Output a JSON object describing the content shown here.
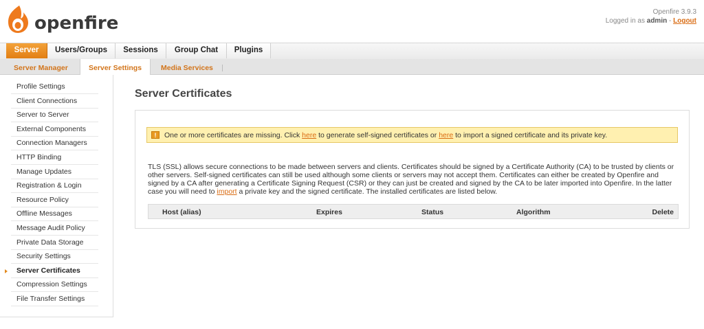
{
  "header": {
    "logo_text": "openfire",
    "logo_tm": "™",
    "version": "Openfire 3.9.3",
    "logged_in_prefix": "Logged in as",
    "username": "admin",
    "separator": "-",
    "logout_label": "Logout"
  },
  "main_tabs": [
    "Server",
    "Users/Groups",
    "Sessions",
    "Group Chat",
    "Plugins"
  ],
  "sub_tabs": [
    "Server Manager",
    "Server Settings",
    "Media Services"
  ],
  "sidebar": {
    "items": [
      "Profile Settings",
      "Client Connections",
      "Server to Server",
      "External Components",
      "Connection Managers",
      "HTTP Binding",
      "Manage Updates",
      "Registration & Login",
      "Resource Policy",
      "Offline Messages",
      "Message Audit Policy",
      "Private Data Storage",
      "Security Settings",
      "Server Certificates",
      "Compression Settings",
      "File Transfer Settings"
    ],
    "active_index": 13
  },
  "page": {
    "title": "Server Certificates"
  },
  "warning": {
    "icon": "!",
    "text_1": "One or more certificates are missing. Click",
    "link_1": "here",
    "text_2": "to generate self-signed certificates or",
    "link_2": "here",
    "text_3": "to import a signed certificate and its private key."
  },
  "description": {
    "text_1": "TLS (SSL) allows secure connections to be made between servers and clients. Certificates should be signed by a Certificate Authority (CA) to be trusted by clients or other servers. Self-signed certificates can still be used although some clients or servers may not accept them. Certificates can either be created by Openfire and signed by a CA after generating a Certificate Signing Request (CSR) or they can just be created and signed by the CA to be later imported into Openfire. In the latter case you will need to",
    "import_link": "import",
    "text_2": "a private key and the signed certificate. The installed certificates are listed below."
  },
  "table": {
    "columns": [
      "Host (alias)",
      "Expires",
      "Status",
      "Algorithm",
      "Delete"
    ]
  },
  "colors": {
    "accent": "#e27f14",
    "link": "#d96b12",
    "warning_bg": "#fff0b0"
  }
}
